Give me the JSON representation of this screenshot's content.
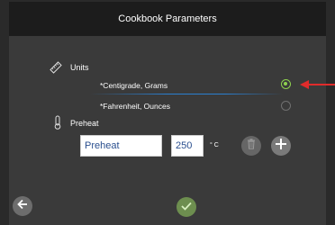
{
  "header": {
    "title": "Cookbook Parameters"
  },
  "units": {
    "label": "Units",
    "icon": "ruler-icon",
    "options": [
      {
        "label": "*Centigrade, Grams",
        "selected": true
      },
      {
        "label": "*Fahrenheit, Ounces",
        "selected": false
      }
    ]
  },
  "preheat": {
    "label": "Preheat",
    "icon": "thermometer-icon",
    "name_value": "Preheat",
    "temp_value": "250",
    "unit": "° C"
  },
  "footer": {
    "back_icon": "arrow-left-icon",
    "confirm_icon": "checkmark-icon"
  },
  "colors": {
    "accent_green": "#8fd14f",
    "selection_blue": "#2a7fd0",
    "annotation_red": "#e02b2b",
    "header_bg": "#1c1c1c",
    "panel_bg": "#3a3a3a"
  }
}
